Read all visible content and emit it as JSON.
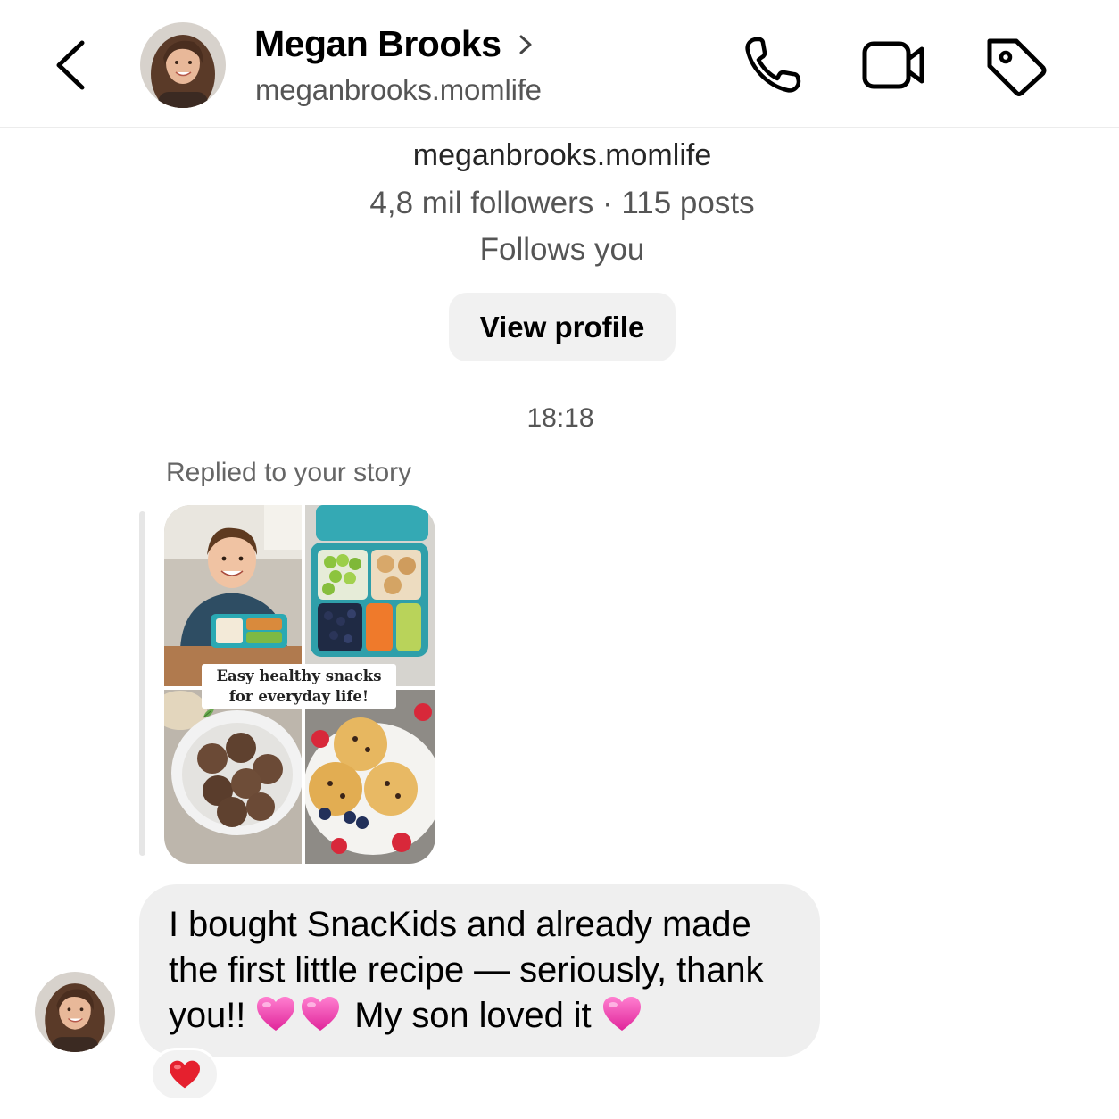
{
  "header": {
    "name": "Megan Brooks",
    "handle": "meganbrooks.momlife",
    "icons": [
      "back-chevron-icon",
      "phone-icon",
      "video-camera-icon",
      "tag-icon"
    ]
  },
  "profile": {
    "handle": "meganbrooks.momlife",
    "stats": "4,8 mil followers · 115 posts",
    "follows": "Follows you",
    "view_button": "View profile"
  },
  "thread": {
    "timestamp": "18:18",
    "reply_label": "Replied to your story",
    "story": {
      "caption_line1": "Easy healthy snacks",
      "caption_line2": "for everyday life!"
    },
    "message": {
      "part1": "I bought SnacKids and already made the first little recipe — seriously, thank you!! ",
      "part2": " My son loved it ",
      "emoji": "pink-heart-icon"
    },
    "reaction": "red-heart-icon"
  },
  "colors": {
    "bubble": "#efefef",
    "button": "#f1f1f1",
    "secondary_text": "#555555",
    "pink_heart": "#f04fb0",
    "red_heart": "#e5202e"
  }
}
